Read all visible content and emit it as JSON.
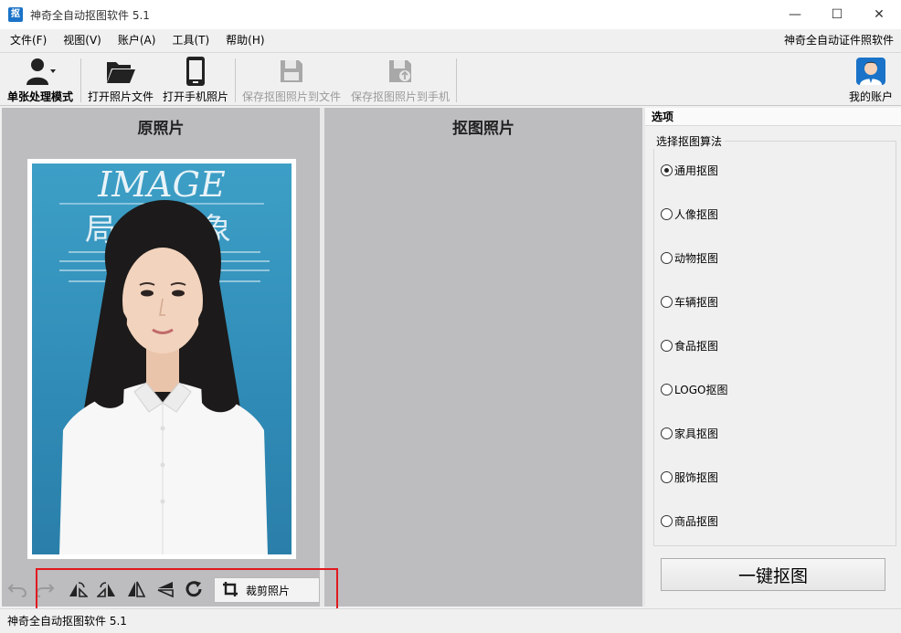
{
  "window": {
    "title": "神奇全自动抠图软件 5.1",
    "app_icon_glyph": "抠",
    "minimize": "—",
    "maximize": "☐",
    "close": "✕"
  },
  "menu": {
    "items": [
      "文件(F)",
      "视图(V)",
      "账户(A)",
      "工具(T)",
      "帮助(H)"
    ],
    "right_link": "神奇全自动证件照软件"
  },
  "toolbar": {
    "single_mode": "单张处理模式",
    "open_file": "打开照片文件",
    "open_phone": "打开手机照片",
    "save_file": "保存抠图照片到文件",
    "save_phone": "保存抠图照片到手机",
    "account": "我的账户"
  },
  "panels": {
    "original_title": "原照片",
    "cutout_title": "抠图照片"
  },
  "photo": {
    "headline": "IMAGE",
    "subtitle": "局部印象"
  },
  "edit_toolbar": {
    "crop_label": "裁剪照片",
    "icons": [
      "undo-icon",
      "redo-icon",
      "rotate-left-icon",
      "rotate-right-icon",
      "flip-horizontal-icon",
      "flip-vertical-icon",
      "rotate-icon",
      "crop-icon"
    ]
  },
  "options": {
    "header": "选项",
    "group_title": "选择抠图算法",
    "algorithms": [
      "通用抠图",
      "人像抠图",
      "动物抠图",
      "车辆抠图",
      "食品抠图",
      "LOGO抠图",
      "家具抠图",
      "服饰抠图",
      "商品抠图"
    ],
    "selected": "通用抠图",
    "one_click_button": "一键抠图"
  },
  "status": {
    "text": "神奇全自动抠图软件 5.1"
  },
  "colors": {
    "accent": "#1a73c8",
    "panel_bg": "#bdbcbf",
    "highlight_box": "#e0191f"
  }
}
